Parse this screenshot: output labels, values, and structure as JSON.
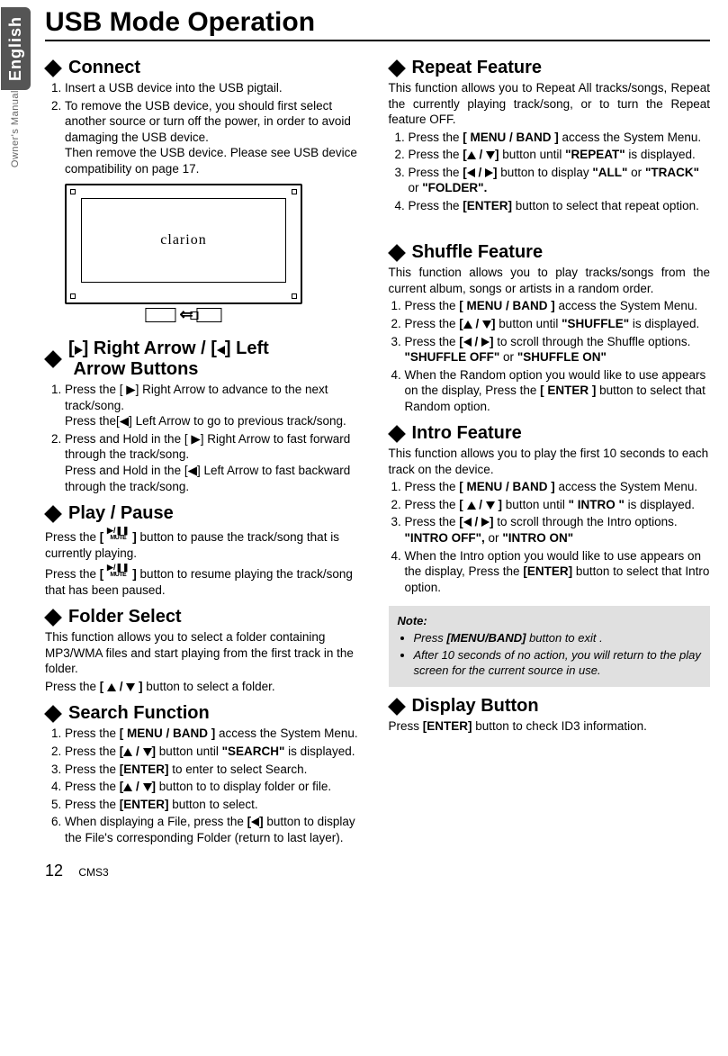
{
  "side": {
    "english": "English",
    "owners": "Owner's Manual"
  },
  "title": "USB Mode Operation",
  "connect": {
    "heading": "Connect",
    "item1": "Insert a USB  device into the USB pigtail.",
    "item2a": "To remove the USB device, you should first select another source or turn off the power, in order to avoid damaging the USB device.",
    "item2b": "Then remove the USB device. Please see USB device compatibility on page 17.",
    "brand": "clarion"
  },
  "arrows": {
    "heading_plain": "[▶] Right Arrow / [◀] Left Arrow Buttons",
    "item1a": "Press the [ ▶] Right Arrow to advance to the next track/song.",
    "item1b": "Press the[◀] Left Arrow to go to previous track/song.",
    "item2a": "Press and Hold in the [ ▶] Right Arrow to fast forward through the track/song.",
    "item2b": "Press and Hold in the [◀] Left Arrow to fast backward through the track/song."
  },
  "play": {
    "heading": "Play / Pause",
    "p1a": "Press the ",
    "p1b": " button to pause the track/song that is currently playing.",
    "p2a": "Press the ",
    "p2b": " button to resume playing the track/song that has been paused."
  },
  "folder": {
    "heading": "Folder Select",
    "desc": "This function allows you to select a folder containing MP3/WMA files and start playing from the first track in the folder.",
    "press": "Press the [ ▲ / ▼ ] button to select a folder."
  },
  "search": {
    "heading": "Search Function",
    "i1a": "Press the ",
    "i1b": "[ MENU / BAND ]",
    "i1c": " access the System Menu.",
    "i2a": "Press the ",
    "i2b": "[▲ / ▼]",
    "i2c": " button until ",
    "i2d": "\"SEARCH\"",
    "i2e": " is displayed.",
    "i3a": "Press the ",
    "i3b": "[ENTER]",
    "i3c": " to enter to select Search.",
    "i4a": "Press the ",
    "i4b": "[▲ / ▼]",
    "i4c": " button to to display folder or file.",
    "i5a": "Press the ",
    "i5b": "[ENTER]",
    "i5c": " button to select.",
    "i6a": "When displaying a File, press the ",
    "i6b": "[◀]",
    "i6c": " button to display the File's corresponding Folder (return to last layer)."
  },
  "repeat": {
    "heading": "Repeat Feature",
    "desc": "This function allows you to Repeat All tracks/songs, Repeat the currently playing track/song, or to turn the Repeat feature OFF.",
    "i1a": "Press the ",
    "i1b": "[ MENU / BAND ]",
    "i1c": " access the System Menu.",
    "i2a": "Press the ",
    "i2b": "[▲ / ▼]",
    "i2c": " button until ",
    "i2d": "\"REPEAT\"",
    "i2e": " is displayed.",
    "i3a": "Press the ",
    "i3b": "[◀ / ▶]",
    "i3c": " button to display ",
    "i3d": "\"ALL\"",
    "i3e": " or ",
    "i3f": "\"TRACK\"",
    "i3g": " or ",
    "i3h": "\"FOLDER\".",
    "i4a": "Press the ",
    "i4b": "[ENTER]",
    "i4c": " button to select that repeat option."
  },
  "shuffle": {
    "heading": "Shuffle Feature",
    "desc": "This function allows you to play tracks/songs from the current album, songs or artists in a random order.",
    "i1a": "Press the ",
    "i1b": "[ MENU / BAND ]",
    "i1c": " access the System Menu.",
    "i2a": "Press the ",
    "i2b": "[▲ / ▼]",
    "i2c": " button until ",
    "i2d": "\"SHUFFLE\"",
    "i2e": " is displayed.",
    "i3a": "Press the ",
    "i3b": "[◀ / ▶]",
    "i3c": " to scroll through the Shuffle options.",
    "i3d": "\"SHUFFLE OFF\"",
    "i3e": " or ",
    "i3f": "\"SHUFFLE ON\"",
    "i4a": "When the Random option you would like to use appears on the display, Press the ",
    "i4b": "[ ENTER ]",
    "i4c": " button to select that Random option."
  },
  "intro": {
    "heading": "Intro Feature",
    "desc": "This function allows you to play the first 10 seconds to each track on the device.",
    "i1a": "Press the ",
    "i1b": "[ MENU / BAND ]",
    "i1c": " access the System Menu.",
    "i2a": "Press the ",
    "i2b": "[ ▲ / ▼ ]",
    "i2c": " button until ",
    "i2d": "\" INTRO \"",
    "i2e": " is displayed.",
    "i3a": "Press the ",
    "i3b": "[◀ / ▶]",
    "i3c": " to scroll through the Intro options.",
    "i3d": "\"INTRO OFF\",",
    "i3e": " or ",
    "i3f": "\"INTRO ON\"",
    "i4a": "When the Intro option you would like to use appears on the display, Press the ",
    "i4b": "[ENTER]",
    "i4c": " button to select that Intro option."
  },
  "note": {
    "title": "Note:",
    "b1a": "Press ",
    "b1b": "[MENU/BAND]",
    "b1c": " button to exit .",
    "b2": "After 10 seconds of no action, you will return to the play screen for the current source in use."
  },
  "display": {
    "heading": "Display Button",
    "p": "Press [ENTER] button to check ID3 information.",
    "pa": "Press ",
    "pb": "[ENTER]",
    "pc": " button to check ID3 information."
  },
  "footer": {
    "page": "12",
    "model": "CMS3"
  }
}
